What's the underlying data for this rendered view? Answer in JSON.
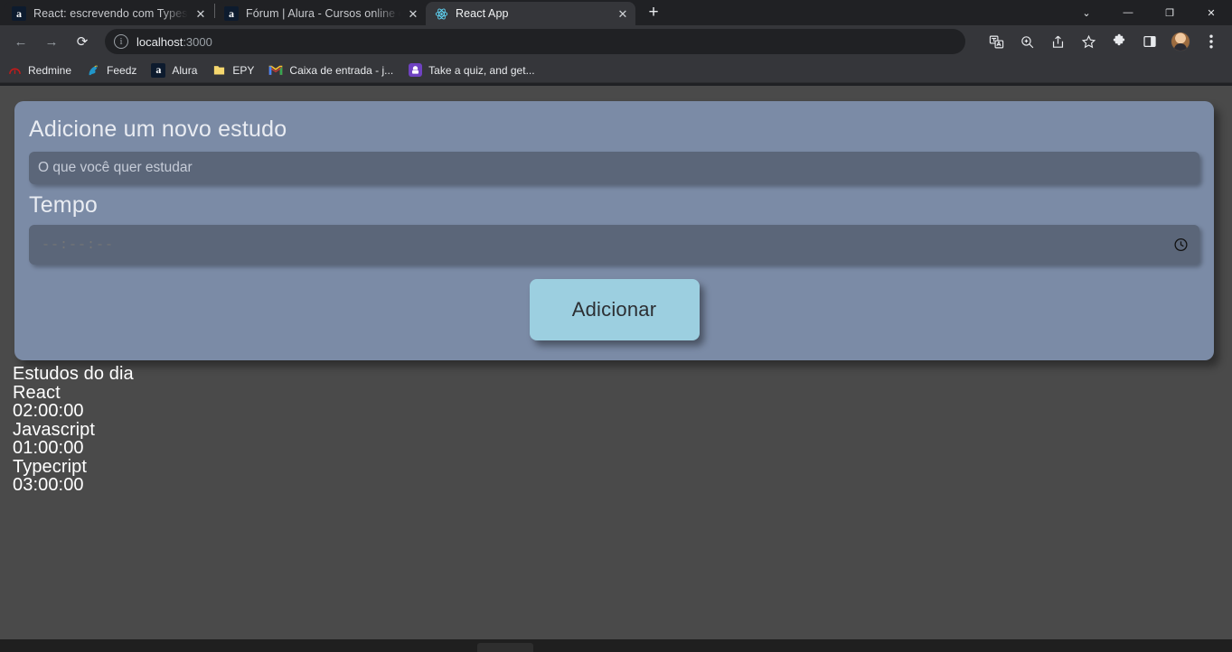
{
  "browser": {
    "tabs": [
      {
        "title": "React: escrevendo com Typescrip",
        "favicon": "alura-icon",
        "active": false
      },
      {
        "title": "Fórum | Alura - Cursos online de",
        "favicon": "alura-icon",
        "active": false
      },
      {
        "title": "React App",
        "favicon": "react-icon",
        "active": true
      }
    ],
    "new_tab_label": "+",
    "tab_close_label": "✕",
    "window_controls": [
      {
        "name": "tab-search-icon",
        "glyph": "⌄"
      },
      {
        "name": "minimize-icon",
        "glyph": "—"
      },
      {
        "name": "maximize-icon",
        "glyph": "❐"
      },
      {
        "name": "close-icon",
        "glyph": "✕"
      }
    ],
    "nav": {
      "back_glyph": "←",
      "forward_glyph": "→",
      "reload_glyph": "⟳"
    },
    "omnibox": {
      "host": "localhost",
      "port": ":3000",
      "info_glyph": "i"
    },
    "toolbar_icons": [
      {
        "name": "translate-icon"
      },
      {
        "name": "zoom-icon"
      },
      {
        "name": "share-icon"
      },
      {
        "name": "bookmark-star-icon"
      },
      {
        "name": "extensions-puzzle-icon"
      },
      {
        "name": "side-panel-icon"
      },
      {
        "name": "profile-avatar"
      },
      {
        "name": "chrome-menu-icon"
      }
    ],
    "bookmarks": [
      {
        "label": "Redmine",
        "icon": "redmine-icon"
      },
      {
        "label": "Feedz",
        "icon": "feedz-icon"
      },
      {
        "label": "Alura",
        "icon": "alura-icon"
      },
      {
        "label": "EPY",
        "icon": "folder-icon"
      },
      {
        "label": "Caixa de entrada - j...",
        "icon": "gmail-icon"
      },
      {
        "label": "Take a quiz, and get...",
        "icon": "quiz-icon"
      }
    ]
  },
  "app": {
    "form": {
      "heading": "Adicione um novo estudo",
      "study_placeholder": "O que você quer estudar",
      "study_value": "",
      "time_label": "Tempo",
      "time_placeholder": "--:--:--",
      "time_value": "",
      "submit_label": "Adicionar",
      "clock_icon": "clock-icon"
    },
    "list": {
      "heading": "Estudos do dia",
      "items": [
        {
          "name": "React",
          "time": "02:00:00"
        },
        {
          "name": "Javascript",
          "time": "01:00:00"
        },
        {
          "name": "Typecript",
          "time": "03:00:00"
        }
      ]
    },
    "colors": {
      "page_background": "#4a4a4a",
      "card_background": "#7b8ba6",
      "input_background": "#5b6679",
      "button_background": "#9ccfe0",
      "text_light": "#e9ecf2"
    }
  }
}
